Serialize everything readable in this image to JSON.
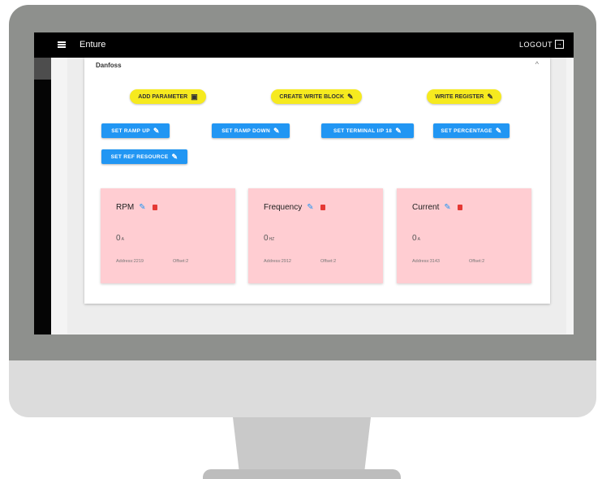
{
  "app": {
    "title": "Enture",
    "logout_label": "LOGOUT",
    "logout_icon": "logout-icon"
  },
  "card": {
    "title": "Danfoss",
    "collapse_icon": "chevron-up-icon"
  },
  "actions": [
    {
      "label": "ADD PARAMETER",
      "icon": "save-icon"
    },
    {
      "label": "CREATE WRITE BLOCK",
      "icon": "build-icon"
    },
    {
      "label": "WRITE REGISTER",
      "icon": "edit-icon"
    }
  ],
  "set_buttons": [
    {
      "label": "SET RAMP UP"
    },
    {
      "label": "SET RAMP DOWN"
    },
    {
      "label": "SET TERMINAL I/P 18"
    },
    {
      "label": "SET PERCENTAGE"
    },
    {
      "label": "SET REF RESOURCE"
    }
  ],
  "parameters": [
    {
      "name": "RPM",
      "value": "0",
      "unit": "A",
      "address": "Address:2219",
      "offset": "Offset:2"
    },
    {
      "name": "Frequency",
      "value": "0",
      "unit": "HZ",
      "address": "Address:2912",
      "offset": "Offset:2"
    },
    {
      "name": "Current",
      "value": "0",
      "unit": "A",
      "address": "Address:3143",
      "offset": "Offset:2"
    }
  ],
  "colors": {
    "appbar": "#000000",
    "accent_yellow": "#f6ea1f",
    "accent_blue": "#2196f3",
    "param_card": "#ffcdd2",
    "delete": "#e53935"
  }
}
